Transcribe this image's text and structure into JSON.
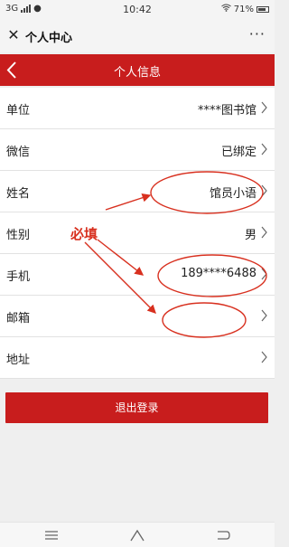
{
  "status_bar": {
    "network": "3G",
    "time": "10:42",
    "battery": "71%"
  },
  "app_bar": {
    "close_icon": "close-icon",
    "title": "个人中心",
    "more": "···"
  },
  "header": {
    "title": "个人信息",
    "back_icon": "chevron-left-icon",
    "color": "#c81d1d"
  },
  "rows": [
    {
      "label": "单位",
      "value": "****图书馆"
    },
    {
      "label": "微信",
      "value": "已绑定"
    },
    {
      "label": "姓名",
      "value": "馆员小语"
    },
    {
      "label": "性别",
      "value": "男"
    },
    {
      "label": "手机",
      "value": "189****6488"
    },
    {
      "label": "邮箱",
      "value": ""
    },
    {
      "label": "地址",
      "value": ""
    }
  ],
  "logout_label": "退出登录",
  "annotation": {
    "text": "必填",
    "color": "#d8301f"
  },
  "nav_bar": {
    "icons": [
      "menu-icon",
      "home-icon",
      "back-icon"
    ]
  }
}
